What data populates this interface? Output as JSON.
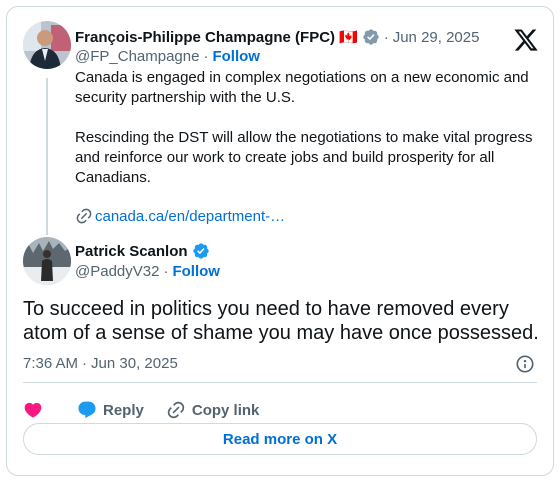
{
  "quoted_tweet": {
    "author_name": "François-Philippe Champagne (FPC)",
    "flag": "🇨🇦",
    "date": "Jun 29, 2025",
    "handle": "@FP_Champagne",
    "follow_label": "Follow",
    "paragraphs": [
      "Canada is engaged in complex negotiations on a new economic and security partnership with the U.S.",
      "Rescinding the DST will allow the negotiations to make vital progress and reinforce our work to create jobs and build prosperity for all Canadians."
    ],
    "link_text": "canada.ca/en/department-…"
  },
  "main_tweet": {
    "author_name": "Patrick Scanlon",
    "handle": "@PaddyV32",
    "follow_label": "Follow",
    "text": "To succeed in politics you need to have removed every atom of a sense of shame you may have once possessed.",
    "time": "7:36 AM",
    "date": "Jun 30, 2025"
  },
  "actions": {
    "reply_label": "Reply",
    "copy_link_label": "Copy link"
  },
  "read_more_label": "Read more on X",
  "separator": "·",
  "colors": {
    "link_blue": "#006fd6",
    "verified_blue": "#1d9bf0",
    "verified_gray": "#829aab",
    "heart_pink": "#f91880",
    "text_gray": "#536471",
    "border": "#cfd9de"
  },
  "icons": {
    "x_logo": "x-logo-icon",
    "verified": "verified-badge-icon",
    "link": "link-icon",
    "info": "info-icon",
    "heart": "heart-icon",
    "reply": "reply-bubble-icon",
    "copy_link": "chain-link-icon"
  }
}
